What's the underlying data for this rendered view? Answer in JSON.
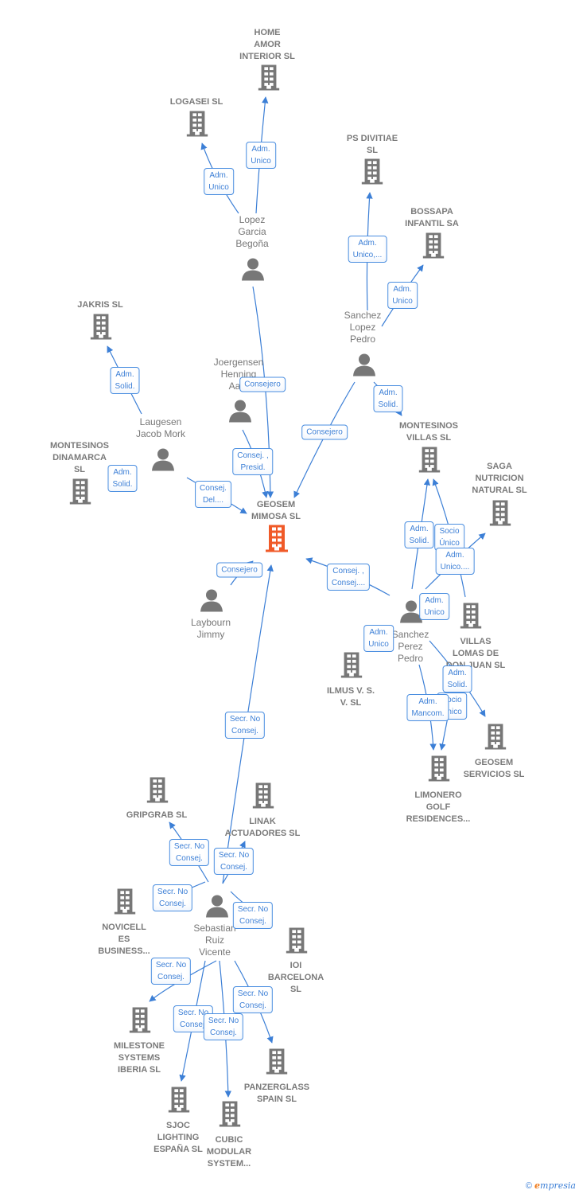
{
  "colors": {
    "company": "#777777",
    "main_company": "#f05a28",
    "edge": "#3c7fd6"
  },
  "main_company": {
    "name": "GEOSEM\nMIMOSA  SL"
  },
  "companies": [
    {
      "name": "HOME\nAMOR\nINTERIOR  SL"
    },
    {
      "name": "LOGASEI SL"
    },
    {
      "name": "PS DIVITIAE\nSL"
    },
    {
      "name": "BOSSAPA\nINFANTIL SA"
    },
    {
      "name": "JAKRIS  SL"
    },
    {
      "name": "MONTESINOS\nDINAMARCA\nSL"
    },
    {
      "name": "MONTESINOS\nVILLAS  SL"
    },
    {
      "name": "SAGA\nNUTRICION\nNATURAL  SL"
    },
    {
      "name": "VILLAS\nLOMAS DE\nDON JUAN SL"
    },
    {
      "name": "ILMUS V.  S.\nV.  SL"
    },
    {
      "name": "GEOSEM\nSERVICIOS  SL"
    },
    {
      "name": "LIMONERO\nGOLF\nRESIDENCES..."
    },
    {
      "name": "GRIPGRAB  SL"
    },
    {
      "name": "LINAK\nACTUADORES SL"
    },
    {
      "name": "NOVICELL\nES\nBUSINESS..."
    },
    {
      "name": "IOI\nBARCELONA\nSL"
    },
    {
      "name": "MILESTONE\nSYSTEMS\nIBERIA  SL"
    },
    {
      "name": "PANZERGLASS\nSPAIN  SL"
    },
    {
      "name": "SJOC\nLIGHTING\nESPAÑA SL"
    },
    {
      "name": "CUBIC\nMODULAR\nSYSTEM..."
    }
  ],
  "persons": [
    {
      "name": "Lopez\nGarcia\nBegoña"
    },
    {
      "name": "Sanchez\nLopez\nPedro"
    },
    {
      "name": "Joergensen\nHenning\nAa..."
    },
    {
      "name": "Laugesen\nJacob Mork"
    },
    {
      "name": "Laybourn\nJimmy"
    },
    {
      "name": "Sanchez\nPerez\nPedro"
    },
    {
      "name": "Sebastian\nRuiz\nVicente"
    }
  ],
  "relations": [
    "Adm.\nUnico",
    "Adm.\nUnico",
    "Adm.\nUnico,...",
    "Adm.\nUnico",
    "Adm.\nSolid.",
    "Consejero",
    "Adm.\nSolid.",
    "Consejero",
    "Consej. ,\nPresid.",
    "Adm.\nSolid.",
    "Consej.\nDel....",
    "Consejero",
    "Consej. ,\nConsej....",
    "Adm.\nSolid.",
    "Socio\nÚnico",
    "Adm.\nUnico....",
    "Adm.\nUnico",
    "Adm.\nUnico",
    "Adm.\nSolid.",
    "Socio\nÚnico",
    "Adm.\nMancom.",
    "Secr.  No\nConsej.",
    "Secr.  No\nConsej.",
    "Secr.  No\nConsej.",
    "Secr.  No\nConsej.",
    "Secr.  No\nConsej.",
    "Secr.  No\nConsej.",
    "Secr.  No\nConsej.",
    "Secr.  No\nConsej.",
    "Secr.  No\nConsej."
  ],
  "footer": {
    "copyright": "©",
    "brand_initial": "e",
    "brand_rest": "mpresia"
  }
}
